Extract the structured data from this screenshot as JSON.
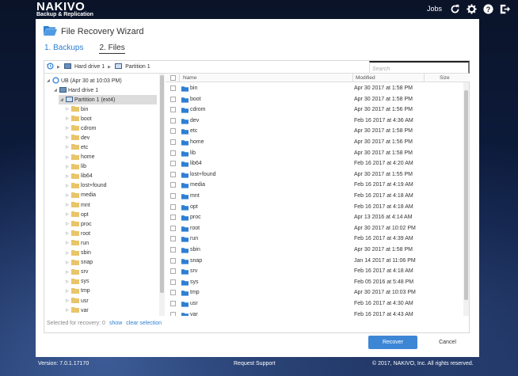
{
  "app": {
    "logo_main": "NAKIVO",
    "logo_sub": "Backup & Replication",
    "jobs_label": "Jobs",
    "icons": [
      "refresh-icon",
      "gear-icon",
      "help-icon",
      "logout-icon"
    ]
  },
  "wizard": {
    "title": "File Recovery Wizard",
    "steps": [
      {
        "label": "1. Backups",
        "active": false
      },
      {
        "label": "2. Files",
        "active": true
      }
    ]
  },
  "breadcrumb": {
    "items": [
      "Hard drive 1",
      "Partition 1"
    ]
  },
  "search": {
    "placeholder": "Search"
  },
  "tree": {
    "root": "UB (Apr 30 at 10:03 PM)",
    "drive": "Hard drive 1",
    "partition": "Partition 1 (ext4)",
    "folders": [
      "bin",
      "boot",
      "cdrom",
      "dev",
      "etc",
      "home",
      "lib",
      "lib64",
      "lost+found",
      "media",
      "mnt",
      "opt",
      "proc",
      "root",
      "run",
      "sbin",
      "snap",
      "srv",
      "sys",
      "tmp",
      "usr",
      "var"
    ]
  },
  "grid": {
    "columns": {
      "name": "Name",
      "modified": "Modified",
      "size": "Size"
    },
    "rows": [
      {
        "name": "bin",
        "modified": "Apr 30 2017 at 1:58 PM"
      },
      {
        "name": "boot",
        "modified": "Apr 30 2017 at 1:58 PM"
      },
      {
        "name": "cdrom",
        "modified": "Apr 30 2017 at 1:56 PM"
      },
      {
        "name": "dev",
        "modified": "Feb 16 2017 at 4:36 AM"
      },
      {
        "name": "etc",
        "modified": "Apr 30 2017 at 1:58 PM"
      },
      {
        "name": "home",
        "modified": "Apr 30 2017 at 1:56 PM"
      },
      {
        "name": "lib",
        "modified": "Apr 30 2017 at 1:58 PM"
      },
      {
        "name": "lib64",
        "modified": "Feb 16 2017 at 4:20 AM"
      },
      {
        "name": "lost+found",
        "modified": "Apr 30 2017 at 1:55 PM"
      },
      {
        "name": "media",
        "modified": "Feb 16 2017 at 4:19 AM"
      },
      {
        "name": "mnt",
        "modified": "Feb 16 2017 at 4:18 AM"
      },
      {
        "name": "opt",
        "modified": "Feb 16 2017 at 4:18 AM"
      },
      {
        "name": "proc",
        "modified": "Apr 13 2016 at 4:14 AM"
      },
      {
        "name": "root",
        "modified": "Apr 30 2017 at 10:02 PM"
      },
      {
        "name": "run",
        "modified": "Feb 16 2017 at 4:39 AM"
      },
      {
        "name": "sbin",
        "modified": "Apr 30 2017 at 1:58 PM"
      },
      {
        "name": "snap",
        "modified": "Jan 14 2017 at 11:06 PM"
      },
      {
        "name": "srv",
        "modified": "Feb 16 2017 at 4:18 AM"
      },
      {
        "name": "sys",
        "modified": "Feb 05 2016 at 5:48 PM"
      },
      {
        "name": "tmp",
        "modified": "Apr 30 2017 at 10:03 PM"
      },
      {
        "name": "usr",
        "modified": "Feb 16 2017 at 4:30 AM"
      },
      {
        "name": "var",
        "modified": "Feb 16 2017 at 4:43 AM"
      }
    ]
  },
  "selection": {
    "label": "Selected for recovery: 0",
    "show": "show",
    "clear": "clear selection"
  },
  "buttons": {
    "recover": "Recover",
    "cancel": "Cancel"
  },
  "footer": {
    "version": "Version: 7.0.1.17170",
    "support": "Request Support",
    "copyright": "© 2017, NAKIVO, Inc. All rights reserved."
  },
  "colors": {
    "accent": "#2d7fd3",
    "folder": "#2d7fd3",
    "tree_folder": "#e8c56a"
  }
}
